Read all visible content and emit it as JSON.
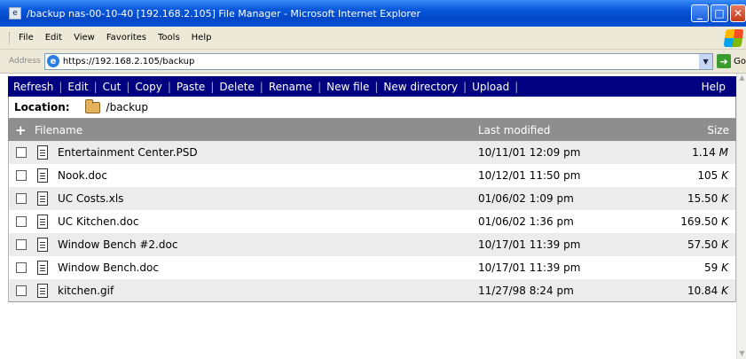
{
  "window": {
    "title": "/backup nas-00-10-40 [192.168.2.105] File Manager - Microsoft Internet Explorer",
    "icon": "ie-page-icon"
  },
  "menubar": {
    "items": [
      "File",
      "Edit",
      "View",
      "Favorites",
      "Tools",
      "Help"
    ]
  },
  "addressbar": {
    "label": "Address",
    "url": "https://192.168.2.105/backup",
    "go_label": "Go"
  },
  "toolbar": {
    "actions": [
      "Refresh",
      "Edit",
      "Cut",
      "Copy",
      "Paste",
      "Delete",
      "Rename",
      "New file",
      "New directory",
      "Upload"
    ],
    "help_label": "Help"
  },
  "location": {
    "label": "Location:",
    "path": "/backup"
  },
  "table": {
    "headers": {
      "filename": "Filename",
      "modified": "Last modified",
      "size": "Size"
    },
    "rows": [
      {
        "name": "Entertainment Center.PSD",
        "modified": "10/11/01 12:09 pm",
        "size": "1.14",
        "unit": "M"
      },
      {
        "name": "Nook.doc",
        "modified": "10/12/01 11:50 pm",
        "size": "105",
        "unit": "K"
      },
      {
        "name": "UC Costs.xls",
        "modified": "01/06/02 1:09 pm",
        "size": "15.50",
        "unit": "K"
      },
      {
        "name": "UC Kitchen.doc",
        "modified": "01/06/02 1:36 pm",
        "size": "169.50",
        "unit": "K"
      },
      {
        "name": "Window Bench #2.doc",
        "modified": "10/17/01 11:39 pm",
        "size": "57.50",
        "unit": "K"
      },
      {
        "name": "Window Bench.doc",
        "modified": "10/17/01 11:39 pm",
        "size": "59",
        "unit": "K"
      },
      {
        "name": "kitchen.gif",
        "modified": "11/27/98 8:24 pm",
        "size": "10.84",
        "unit": "K"
      }
    ]
  },
  "colors": {
    "toolbar_bg": "#000080",
    "header_bg": "#8e8e8e",
    "row_alt_bg": "#ececec",
    "titlebar_bg": "#0a58dc"
  }
}
